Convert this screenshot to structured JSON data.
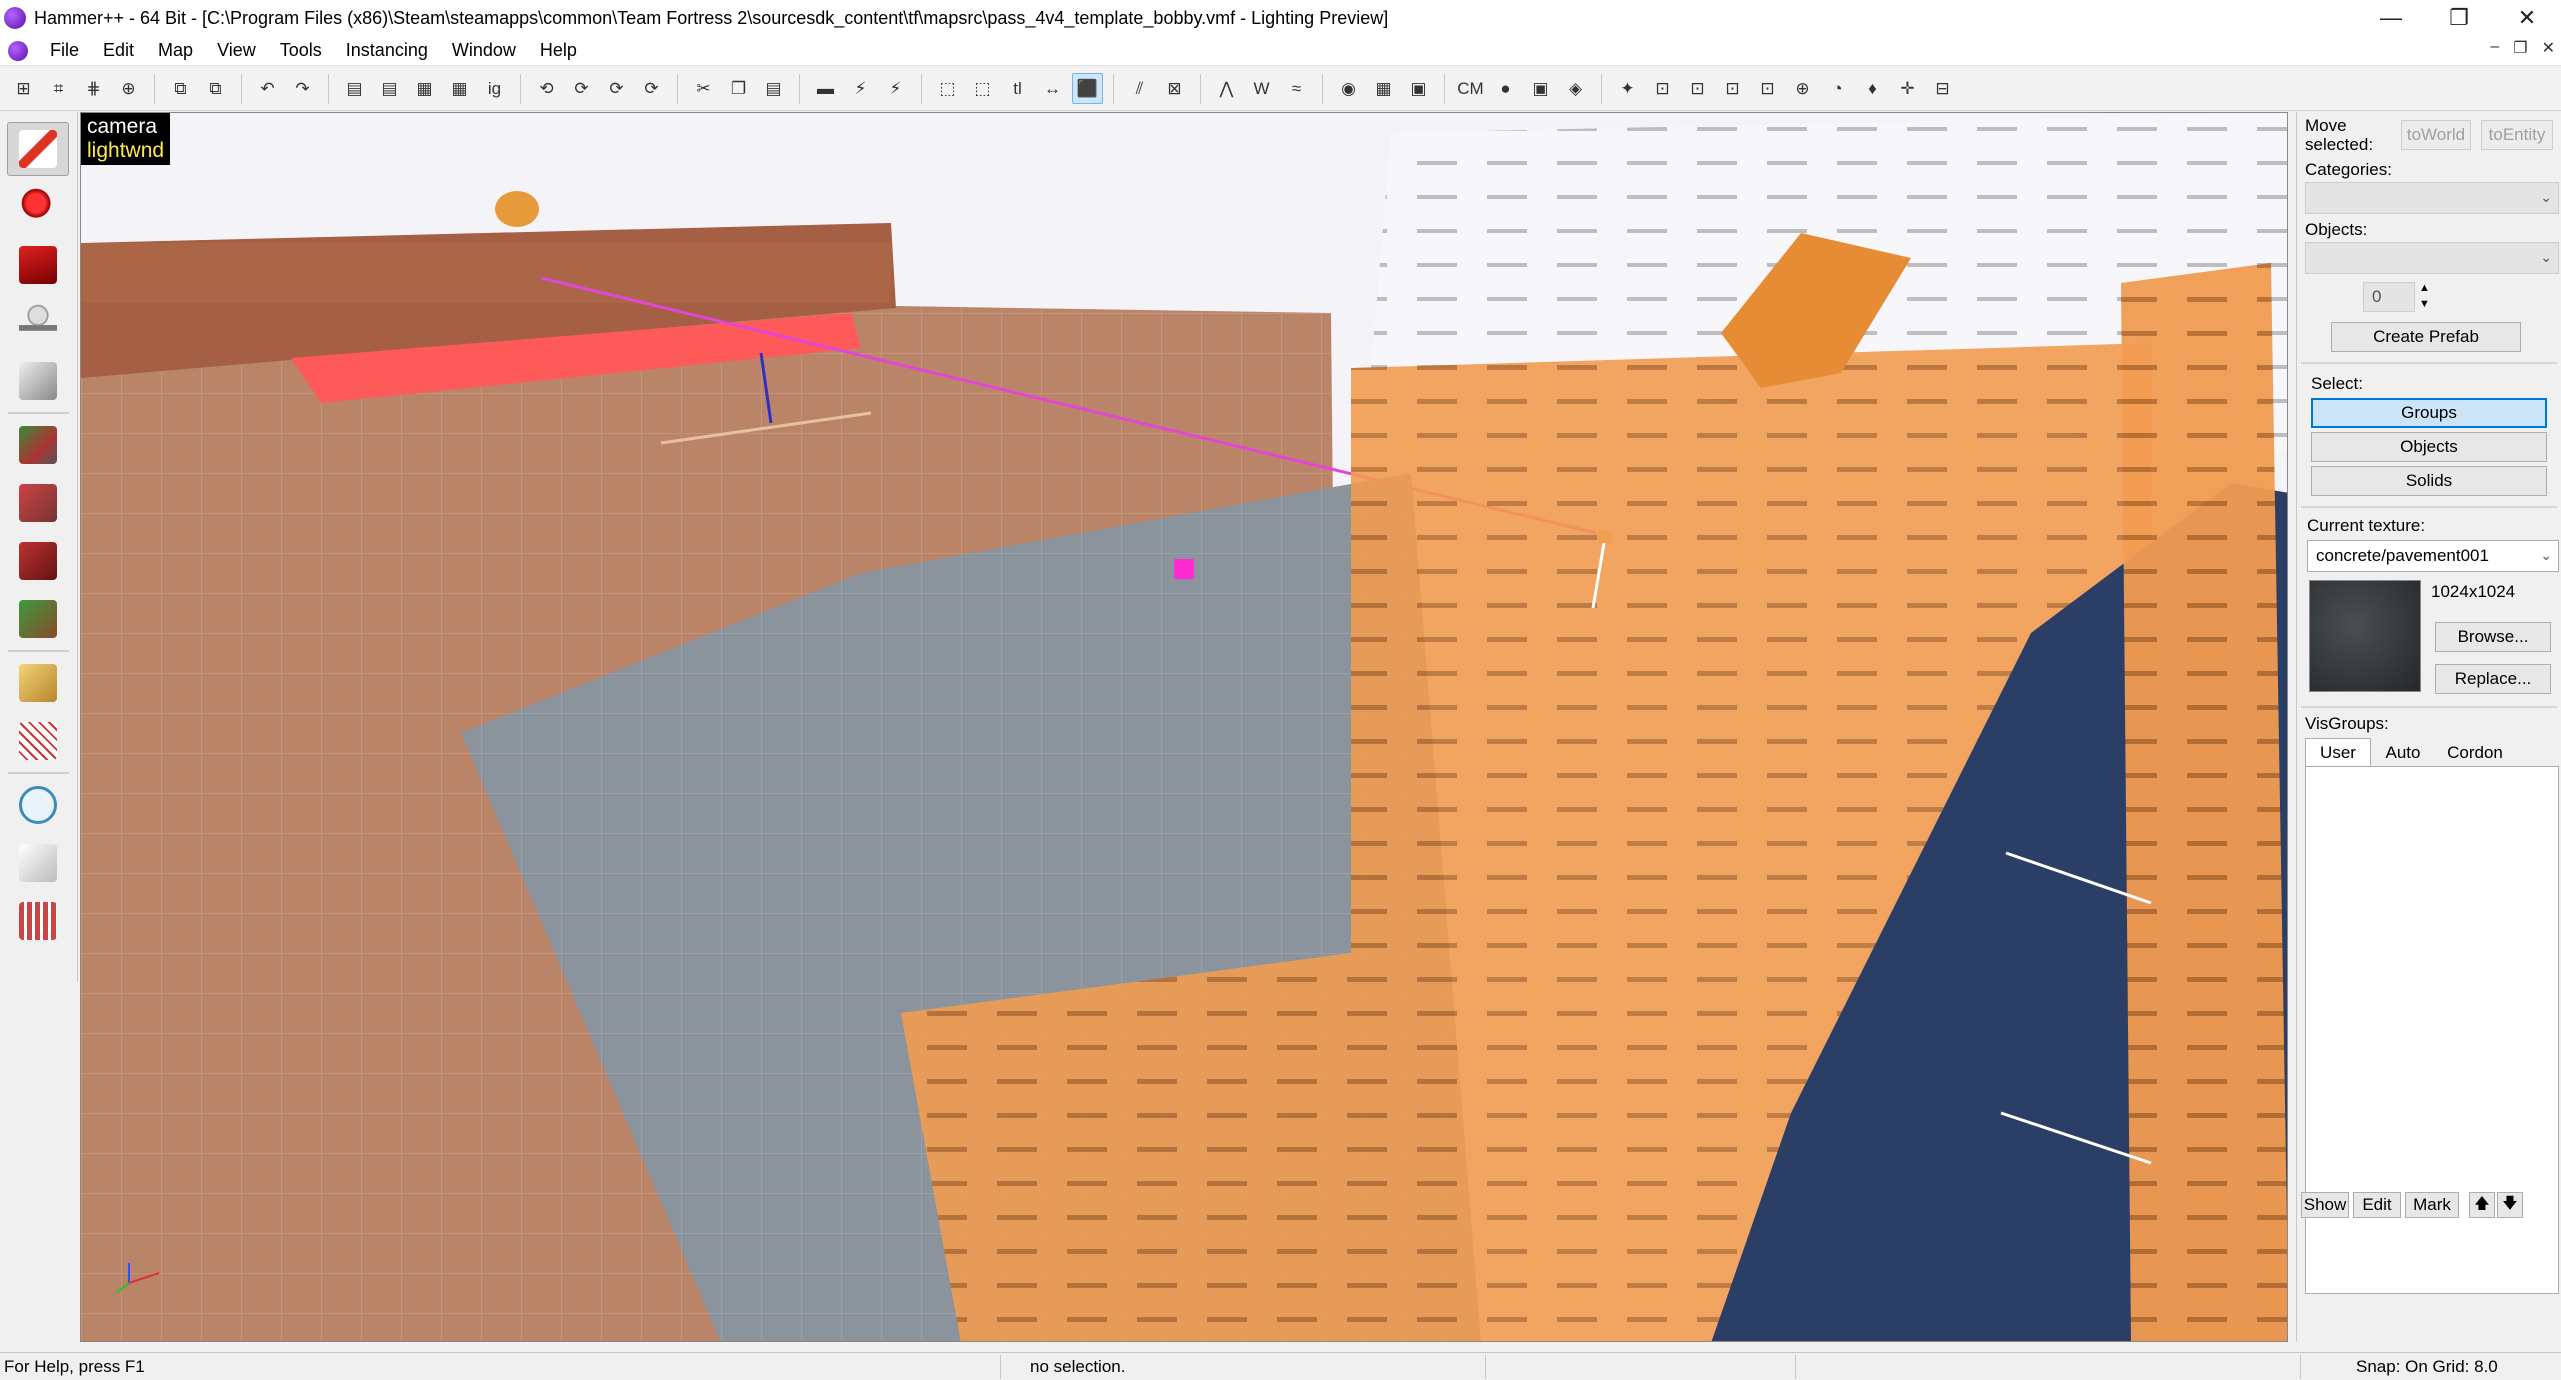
{
  "window": {
    "title": "Hammer++ - 64 Bit - [C:\\Program Files (x86)\\Steam\\steamapps\\common\\Team Fortress 2\\sourcesdk_content\\tf\\mapsrc\\pass_4v4_template_bobby.vmf - Lighting Preview]",
    "minimize": "—",
    "maximize": "❐",
    "close": "✕"
  },
  "menu": {
    "items": [
      "File",
      "Edit",
      "Map",
      "View",
      "Tools",
      "Instancing",
      "Window",
      "Help"
    ],
    "mdi_controls": [
      "–",
      "❐",
      "✕"
    ]
  },
  "toolbar": {
    "buttons": [
      "⊞",
      "⌗",
      "⋕",
      "⊕",
      "⧉",
      "⧉",
      "↶",
      "↷",
      "▤",
      "▤",
      "▦",
      "▦",
      "ig",
      "⟲",
      "⟳",
      "⟳",
      "⟳",
      "✂",
      "❐",
      "▤",
      "▬",
      "⚡",
      "⚡",
      "⬚",
      "⬚",
      "tl",
      "↔",
      "⬛",
      "⫽",
      "⊠",
      "⋀",
      "W",
      "≈",
      "◉",
      "▦",
      "▣",
      "CM",
      "●",
      "▣",
      "◈",
      "✦",
      "⊡",
      "⊡",
      "⊡",
      "⊡",
      "⊕",
      "◔",
      "♦",
      "✛",
      "⊟"
    ],
    "active_index": 27
  },
  "viewport": {
    "camera_label": "camera",
    "mode_label": "lightwnd"
  },
  "right_panel": {
    "move_selected_label": "Move selected:",
    "to_world": "toWorld",
    "to_entity": "toEntity",
    "categories_label": "Categories:",
    "categories_value": "",
    "objects_label": "Objects:",
    "objects_value": "",
    "count_value": "0",
    "create_prefab": "Create Prefab",
    "select_label": "Select:",
    "select_options": [
      "Groups",
      "Objects",
      "Solids"
    ],
    "selected_option": "Groups",
    "current_texture_label": "Current texture:",
    "current_texture_value": "concrete/pavement001",
    "texture_size": "1024x1024",
    "browse": "Browse...",
    "replace": "Replace...",
    "visgroups_label": "VisGroups:",
    "visgroup_tabs": [
      "User",
      "Auto",
      "Cordon"
    ],
    "active_visgroup_tab": "User",
    "visgroup_buttons": [
      "Show",
      "Edit",
      "Mark"
    ],
    "up_arrow": "🡅",
    "down_arrow": "🡇"
  },
  "status": {
    "help": "For Help, press F1",
    "selection": "no selection.",
    "snap": "Snap: On Grid: 8.0"
  },
  "colors": {
    "accent": "#0078d7",
    "floor_brown": "#b98468",
    "floor_grey": "#8b939d",
    "trigger_orange": "#ef9a4a",
    "dark_blue": "#2b3f66",
    "magenta": "#ff2ad4"
  }
}
